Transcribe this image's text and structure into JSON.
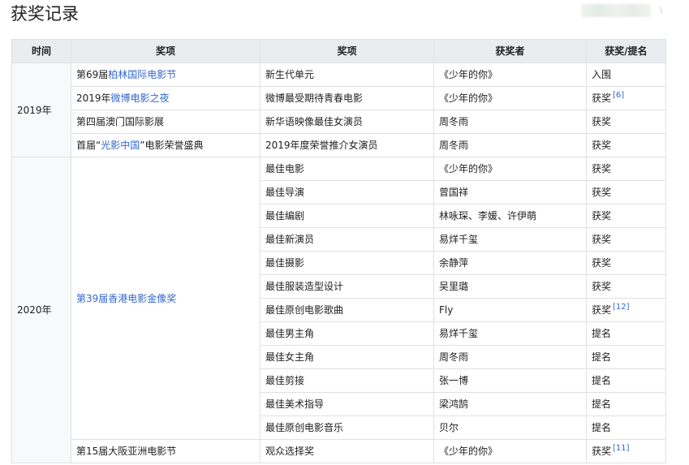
{
  "heading": "获奖记录",
  "headers": [
    "时间",
    "奖项",
    "奖项",
    "获奖者",
    "获奖/提名"
  ],
  "years": {
    "y2019": "2019年",
    "y2020": "2020年"
  },
  "rows": [
    {
      "event_pre": "第69届",
      "event_link": "柏林国际电影节",
      "event_post": "",
      "category": "新生代单元",
      "winner": "《少年的你》",
      "result": "入围",
      "ref": ""
    },
    {
      "event_pre": "2019年",
      "event_link": "微博电影之夜",
      "event_post": "",
      "category": "微博最受期待青春电影",
      "winner": "《少年的你》",
      "result": "获奖",
      "ref": "[6]"
    },
    {
      "event_pre": "第四届澳门国际影展",
      "event_link": "",
      "event_post": "",
      "category": "新华语映像最佳女演员",
      "winner": "周冬雨",
      "result": "获奖",
      "ref": ""
    },
    {
      "event_pre": "首届“",
      "event_link": "光影中国",
      "event_post": "”电影荣誉盛典",
      "category": "2019年度荣誉推介女演员",
      "winner": "周冬雨",
      "result": "获奖",
      "ref": ""
    },
    {
      "event_pre": "",
      "event_link": "第39届香港电影金像奖",
      "event_post": "",
      "category": "最佳电影",
      "winner": "《少年的你》",
      "result": "获奖",
      "ref": ""
    },
    {
      "category": "最佳导演",
      "winner": "曾国祥",
      "result": "获奖",
      "ref": ""
    },
    {
      "category": "最佳编剧",
      "winner": "林咏琛、李媛、许伊萌",
      "result": "获奖",
      "ref": ""
    },
    {
      "category": "最佳新演员",
      "winner": "易烊千玺",
      "result": "获奖",
      "ref": ""
    },
    {
      "category": "最佳摄影",
      "winner": "余静萍",
      "result": "获奖",
      "ref": ""
    },
    {
      "category": "最佳服装造型设计",
      "winner": "吴里璐",
      "result": "获奖",
      "ref": ""
    },
    {
      "category": "最佳原创电影歌曲",
      "winner": "Fly",
      "result": "获奖",
      "ref": "[12]"
    },
    {
      "category": "最佳男主角",
      "winner": "易烊千玺",
      "result": "提名",
      "ref": ""
    },
    {
      "category": "最佳女主角",
      "winner": "周冬雨",
      "result": "提名",
      "ref": ""
    },
    {
      "category": "最佳剪接",
      "winner": "张一博",
      "result": "提名",
      "ref": ""
    },
    {
      "category": "最佳美术指导",
      "winner": "梁鸿鹄",
      "result": "提名",
      "ref": ""
    },
    {
      "category": "最佳原创电影音乐",
      "winner": "贝尔",
      "result": "提名",
      "ref": ""
    },
    {
      "event_pre": "第15届大阪亚洲电影节",
      "event_link": "",
      "event_post": "",
      "category": "观众选择奖",
      "winner": "《少年的你》",
      "result": "获奖",
      "ref": "[11]"
    }
  ]
}
